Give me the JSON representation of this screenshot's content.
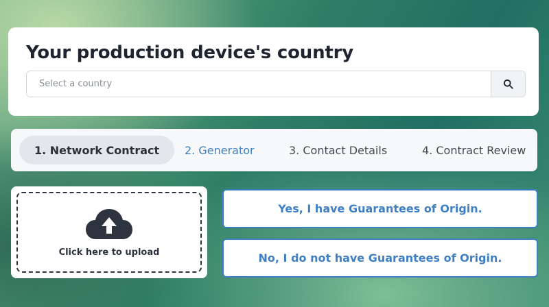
{
  "country_card": {
    "title": "Your production device's country",
    "search_placeholder": "Select a country",
    "search_value": "",
    "search_icon": "search-icon"
  },
  "steps": [
    {
      "label": "1.  Network Contract",
      "state": "active"
    },
    {
      "label": "2.  Generator",
      "state": "next"
    },
    {
      "label": "3.  Contact Details",
      "state": "pending"
    },
    {
      "label": "4.  Contract Review",
      "state": "pending"
    }
  ],
  "upload": {
    "label": "Click here to upload",
    "icon": "cloud-upload-icon"
  },
  "guarantees": {
    "yes_label": "Yes, I have Guarantees of Origin.",
    "no_label": "No, I do not have Guarantees of Origin."
  },
  "colors": {
    "accent": "#3f7fc6",
    "dark": "#2d3440"
  }
}
